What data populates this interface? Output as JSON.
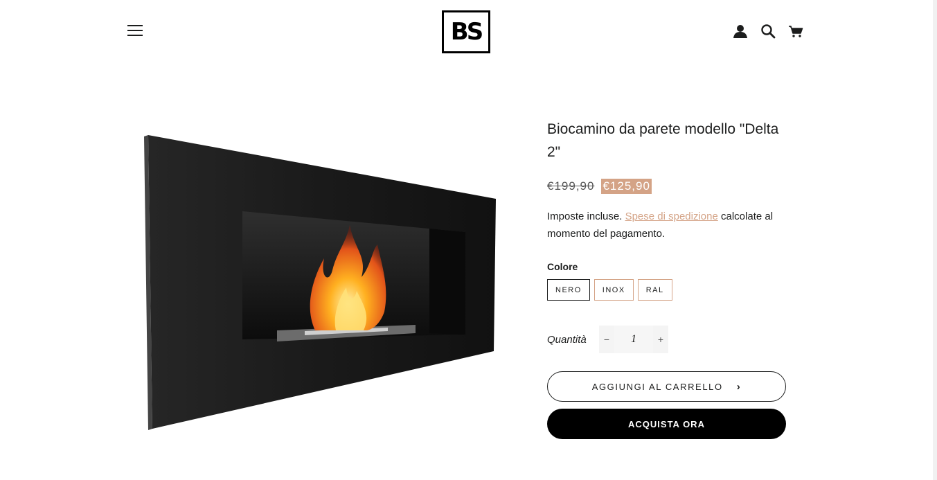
{
  "header": {
    "logo_text": "BS",
    "icons": [
      "menu-icon",
      "account-icon",
      "search-icon",
      "cart-icon"
    ]
  },
  "product": {
    "title": "Biocamino da parete modello \"Delta 2\"",
    "compare_price": "€199,90",
    "price": "€125,90",
    "tax_prefix": "Imposte incluse.",
    "shipping_link": "Spese di spedizione",
    "tax_suffix": "calcolate al momento del pagamento.",
    "color_label": "Colore",
    "colors": [
      "NERO",
      "INOX",
      "RAL"
    ],
    "selected_color": "NERO",
    "quantity_label": "Quantità",
    "quantity": "1",
    "minus": "−",
    "plus": "+",
    "add_to_cart": "AGGIUNGI AL CARRELLO",
    "add_to_cart_chevron": "›",
    "buy_now": "ACQUISTA ORA"
  },
  "colors": {
    "accent": "#d4a386",
    "text": "#1c1d1d",
    "button_dark": "#000000"
  }
}
